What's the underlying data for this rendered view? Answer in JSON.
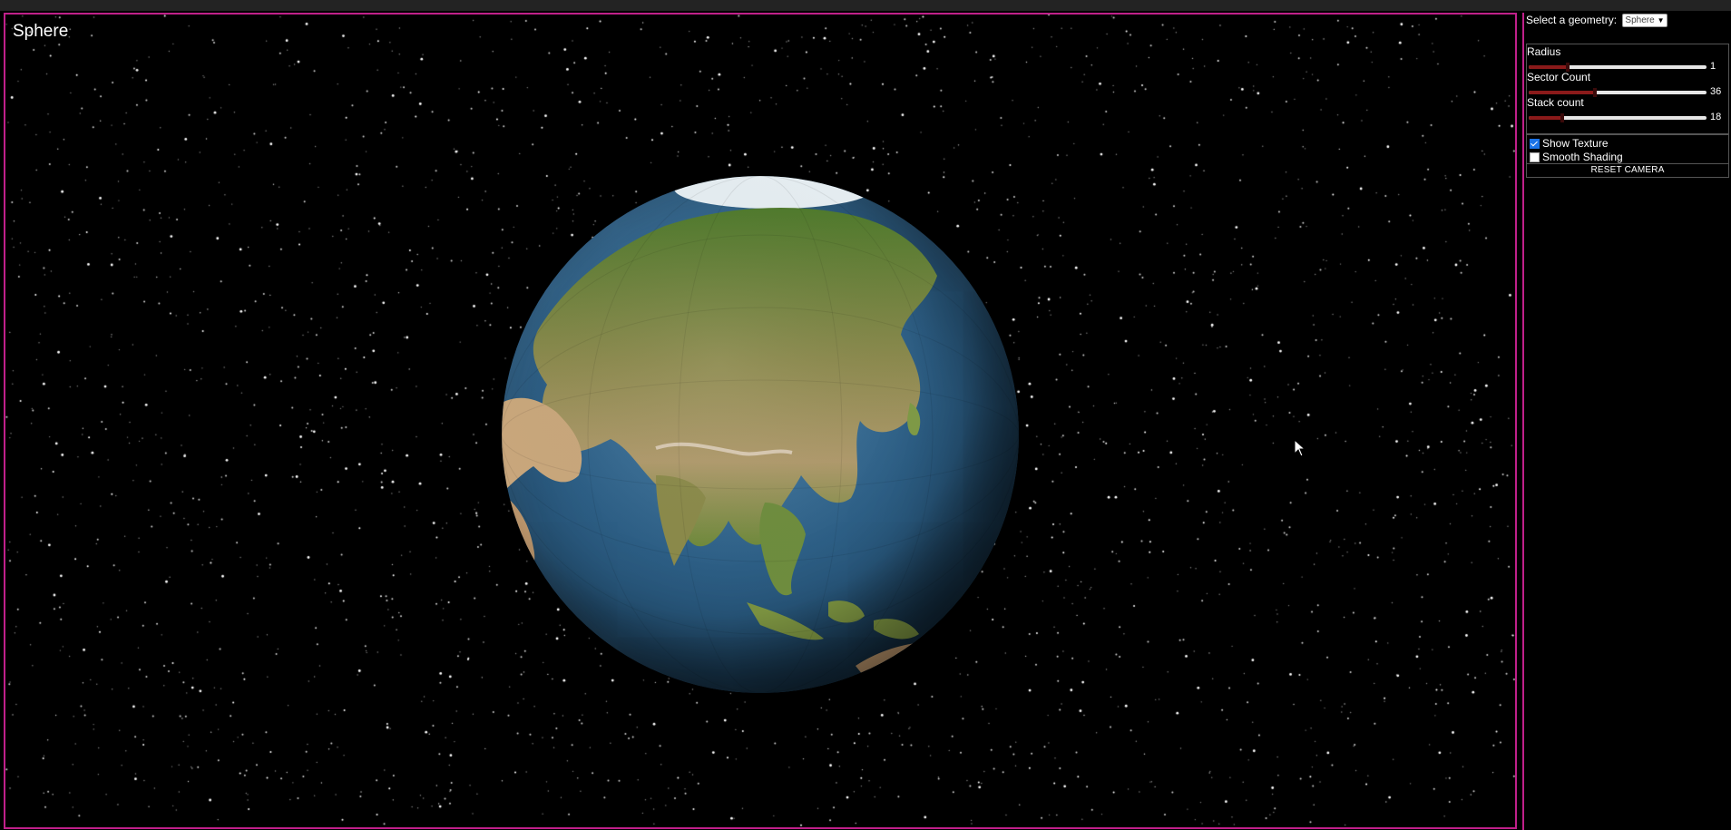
{
  "scene": {
    "title": "Sphere",
    "background": "#000000",
    "frame_color": "#c0208a"
  },
  "controls": {
    "geometry_label": "Select a geometry:",
    "geometry_selected": "Sphere",
    "sliders": [
      {
        "label": "Radius",
        "value": "1",
        "fill": 0.22
      },
      {
        "label": "Sector Count",
        "value": "36",
        "fill": 0.37
      },
      {
        "label": "Stack count",
        "value": "18",
        "fill": 0.19
      }
    ],
    "toggles": [
      {
        "label": "Show Texture",
        "checked": true
      },
      {
        "label": "Smooth Shading",
        "checked": false
      }
    ],
    "reset_label": "RESET CAMERA"
  },
  "icons": {
    "cursor": "mouse-pointer-icon",
    "dropdown": "chevron-down-icon"
  },
  "colors": {
    "slider_fill": "#8b1a1a",
    "ocean": "#2d5f86",
    "land": "#7c8a48"
  }
}
